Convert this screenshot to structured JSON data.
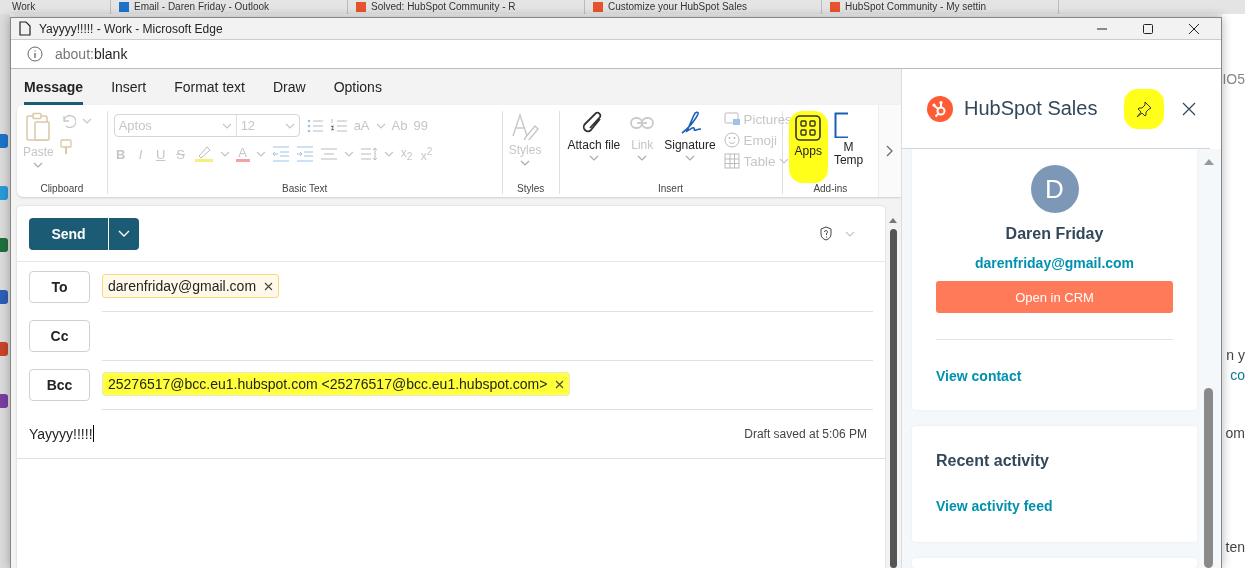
{
  "background": {
    "tabs": [
      {
        "title": "Work"
      },
      {
        "title": "Email - Daren Friday - Outlook"
      },
      {
        "title": "Solved: HubSpot Community - R"
      },
      {
        "title": "Customize your HubSpot Sales"
      },
      {
        "title": "HubSpot Community - My settin"
      }
    ],
    "fragments": [
      "IO5",
      "n y",
      "co",
      "om",
      "ten"
    ]
  },
  "window": {
    "title": "Yayyyy!!!!! - Work - Microsoft Edge",
    "address_scheme": "about:",
    "address_rest": "blank"
  },
  "ribbon_tabs": [
    {
      "label": "Message",
      "selected": true
    },
    {
      "label": "Insert",
      "selected": false
    },
    {
      "label": "Format text",
      "selected": false
    },
    {
      "label": "Draw",
      "selected": false
    },
    {
      "label": "Options",
      "selected": false
    }
  ],
  "ribbon": {
    "clipboard": {
      "label": "Clipboard",
      "paste": {
        "label": "Paste",
        "disabled": true
      }
    },
    "basic_text": {
      "label": "Basic Text",
      "disabled": true,
      "font": "Aptos",
      "size": "12",
      "row1_glyphs": [
        "aA",
        "Ab",
        "99"
      ],
      "row2_glyphs": [
        "B",
        "I",
        "U",
        "S"
      ],
      "script_glyphs": [
        "x$_{2}$",
        "x$^{2}$"
      ],
      "color_glyph": "A"
    },
    "styles": {
      "label": "Styles",
      "button": {
        "label": "Styles",
        "disabled": true
      }
    },
    "insert": {
      "label": "Insert",
      "big": [
        {
          "label": "Attach file",
          "disabled": false
        },
        {
          "label": "Link",
          "disabled": true
        },
        {
          "label": "Signature",
          "disabled": false
        }
      ],
      "small": [
        {
          "label": "Pictures",
          "disabled": true
        },
        {
          "label": "Emoji",
          "disabled": true
        },
        {
          "label": "Table",
          "disabled": true
        }
      ]
    },
    "addins": {
      "label": "Add-ins",
      "apps": {
        "label": "Apps",
        "highlighted": true
      },
      "templates": {
        "lines": [
          "M",
          "Temp"
        ]
      }
    }
  },
  "compose": {
    "send": "Send",
    "recipients": [
      {
        "label": "To",
        "chips": [
          {
            "text": "darenfriday@gmail.com",
            "highlighted": false
          }
        ]
      },
      {
        "label": "Cc"
      },
      {
        "label": "Bcc",
        "chips": [
          {
            "text": "25276517@bcc.eu1.hubspot.com <25276517@bcc.eu1.hubspot.com>",
            "highlighted": true
          }
        ]
      }
    ],
    "subject": "Yayyyy!!!!!",
    "draft_status": "Draft saved at 5:06 PM"
  },
  "side_panel": {
    "title": "HubSpot Sales",
    "pin": {
      "highlighted": true
    },
    "contact": {
      "initial": "D",
      "name": "Daren Friday",
      "email": "darenfriday@gmail.com",
      "button": "Open in CRM",
      "link": "View contact"
    },
    "activity": {
      "title": "Recent activity",
      "link": "View activity feed"
    }
  }
}
